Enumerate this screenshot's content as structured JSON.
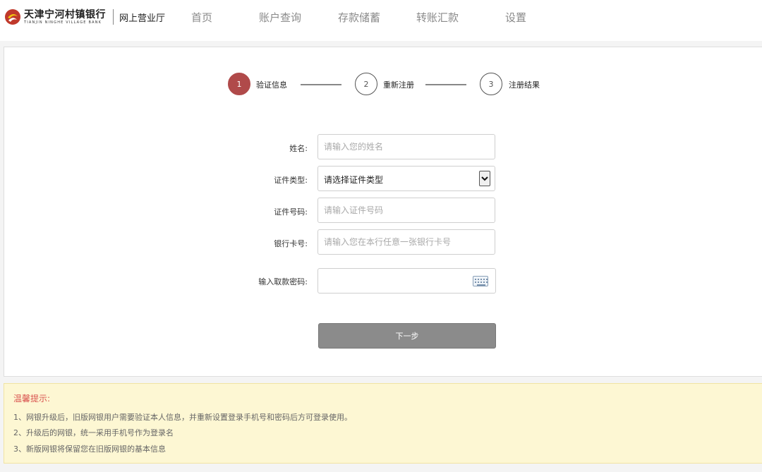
{
  "header": {
    "bank_name_cn": "天津宁河村镇银行",
    "bank_name_en": "TIANJIN NINGHE VILLAGE BANK",
    "subtitle": "网上营业厅",
    "nav": [
      "首页",
      "账户查询",
      "存款储蓄",
      "转账汇款",
      "设置"
    ]
  },
  "steps": [
    {
      "num": "1",
      "label": "验证信息",
      "active": true
    },
    {
      "num": "2",
      "label": "重新注册",
      "active": false
    },
    {
      "num": "3",
      "label": "注册结果",
      "active": false
    }
  ],
  "form": {
    "name_label": "姓名:",
    "name_placeholder": "请输入您的姓名",
    "id_type_label": "证件类型:",
    "id_type_value": "请选择证件类型",
    "id_number_label": "证件号码:",
    "id_number_placeholder": "请输入证件号码",
    "card_label": "银行卡号:",
    "card_placeholder": "请输入您在本行任意一张银行卡号",
    "password_label": "输入取款密码:",
    "next_label": "下一步"
  },
  "tips": {
    "title": "温馨提示:",
    "lines": [
      "1、网银升级后，旧版网银用户需要验证本人信息，并重新设置登录手机号和密码后方可登录使用。",
      "2、升级后的网银，统一采用手机号作为登录名",
      "3、新版网银将保留您在旧版网银的基本信息"
    ]
  },
  "colors": {
    "accent": "#b04a4a",
    "tip_title": "#d9534f",
    "tip_bg": "#fdf7d3",
    "button": "#8b8b8b"
  }
}
